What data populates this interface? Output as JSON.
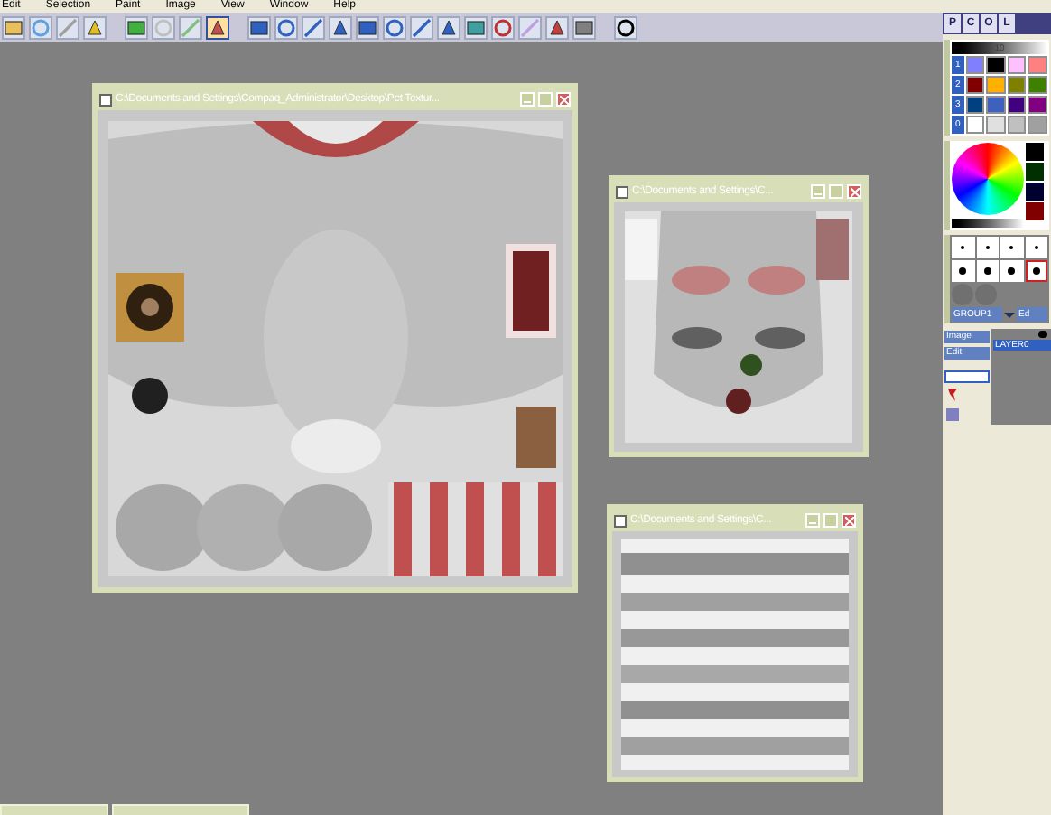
{
  "menu": [
    "Edit",
    "Selection",
    "Paint",
    "Image",
    "View",
    "Window",
    "Help"
  ],
  "toolbar": [
    {
      "selected": false
    },
    {
      "selected": false
    },
    {
      "selected": false
    },
    {
      "selected": false
    },
    {
      "selected": false
    },
    {
      "selected": false
    },
    {
      "selected": false
    },
    {
      "selected": true
    },
    {
      "selected": false
    },
    {
      "selected": false
    },
    {
      "selected": false
    },
    {
      "selected": false
    },
    {
      "selected": false
    },
    {
      "selected": false
    },
    {
      "selected": false
    },
    {
      "selected": false
    },
    {
      "selected": false
    },
    {
      "selected": false
    },
    {
      "selected": false
    },
    {
      "selected": false
    },
    {
      "selected": false
    },
    {
      "selected": false
    }
  ],
  "windows": [
    {
      "title": "C:\\Documents and Settings\\Compaq_Administrator\\Desktop\\Pet Textur...",
      "kind": "pelt"
    },
    {
      "title": "C:\\Documents and Settings\\C...",
      "kind": "face"
    },
    {
      "title": "C:\\Documents and Settings\\C...",
      "kind": "hair"
    }
  ],
  "panel": {
    "tabs": [
      "P",
      "C",
      "O",
      "L"
    ],
    "size_reading": "10",
    "palette": [
      {
        "label": "1",
        "swatches": [
          {
            "color": "#8080ff"
          },
          {
            "color": "#000000"
          },
          {
            "color": "#ffc0ff"
          },
          {
            "color": "#ff8080"
          }
        ]
      },
      {
        "label": "2",
        "swatches": [
          {
            "color": "#800000"
          },
          {
            "color": "#ffb000"
          },
          {
            "color": "#808000"
          },
          {
            "color": "#408000"
          }
        ]
      },
      {
        "label": "3",
        "swatches": [
          {
            "color": "#004080"
          },
          {
            "color": "#4060c0"
          },
          {
            "color": "#400080"
          },
          {
            "color": "#800080"
          }
        ]
      },
      {
        "label": "0",
        "swatches": [
          {
            "color": "#ffffff"
          },
          {
            "color": "#e0e0e0"
          },
          {
            "color": "#c0c0c0"
          },
          {
            "color": "#a0a0a0"
          }
        ]
      }
    ],
    "current_colors": [
      {
        "color": "#000000"
      },
      {
        "color": "#003000"
      },
      {
        "color": "#000030"
      },
      {
        "color": "#800000"
      }
    ],
    "brushes": [
      {
        "selected": false
      },
      {
        "selected": false
      },
      {
        "selected": false
      },
      {
        "selected": false
      },
      {
        "selected": false
      },
      {
        "selected": false
      },
      {
        "selected": false
      },
      {
        "selected": true
      }
    ],
    "group": "GROUP1",
    "group_button": "Ed",
    "buttons": [
      "Image",
      "Edit"
    ],
    "layer": "LAYER0"
  }
}
